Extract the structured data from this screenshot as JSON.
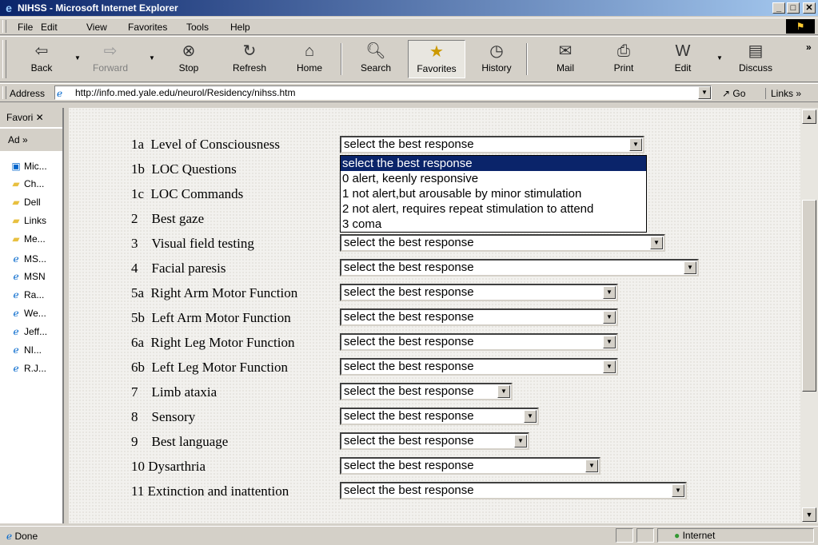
{
  "window": {
    "title": "NIHSS - Microsoft Internet Explorer",
    "min": "_",
    "max": "□",
    "close": "✕"
  },
  "menu": [
    "File",
    "Edit",
    "View",
    "Favorites",
    "Tools",
    "Help"
  ],
  "toolbar": {
    "back": "Back",
    "forward": "Forward",
    "stop": "Stop",
    "refresh": "Refresh",
    "home": "Home",
    "search": "Search",
    "favorites": "Favorites",
    "history": "History",
    "mail": "Mail",
    "print": "Print",
    "edit": "Edit",
    "discuss": "Discuss",
    "more": "»"
  },
  "address": {
    "label": "Address",
    "url": "http://info.med.yale.edu/neurol/Residency/nihss.htm",
    "go": "Go",
    "links": "Links »"
  },
  "sidebar": {
    "header": "Favori ✕",
    "add": "Ad »",
    "items": [
      {
        "icon": "page-icon",
        "label": "Mic..."
      },
      {
        "icon": "folder-icon",
        "label": "Ch..."
      },
      {
        "icon": "folder-icon",
        "label": "Dell"
      },
      {
        "icon": "folder-icon",
        "label": "Links"
      },
      {
        "icon": "folder-icon",
        "label": "Me..."
      },
      {
        "icon": "ie-page-icon",
        "label": "MS..."
      },
      {
        "icon": "ie-page-icon",
        "label": "MSN"
      },
      {
        "icon": "ie-page-icon",
        "label": "Ra..."
      },
      {
        "icon": "ie-page-icon",
        "label": "We..."
      },
      {
        "icon": "ie-page-icon",
        "label": "Jeff..."
      },
      {
        "icon": "ie-page-icon",
        "label": "NI..."
      },
      {
        "icon": "ie-page-icon",
        "label": "R.J..."
      }
    ]
  },
  "form": {
    "placeholder": "select the best response",
    "items": [
      {
        "num": "1a",
        "label": "Level of Consciousness",
        "value": "select the best response"
      },
      {
        "num": "1b",
        "label": "LOC Questions",
        "value": "select the best response"
      },
      {
        "num": "1c",
        "label": "LOC Commands",
        "value": "select the best response"
      },
      {
        "num": "2",
        "label": "Best gaze",
        "value": "select the best response"
      },
      {
        "num": "3",
        "label": "Visual field testing",
        "value": "select the best response"
      },
      {
        "num": "4",
        "label": "Facial paresis",
        "value": "select the best response"
      },
      {
        "num": "5a",
        "label": "Right Arm Motor Function",
        "value": "select the best response"
      },
      {
        "num": "5b",
        "label": "Left Arm Motor Function",
        "value": "select the best response"
      },
      {
        "num": "6a",
        "label": "Right Leg Motor Function",
        "value": "select the best response"
      },
      {
        "num": "6b",
        "label": "Left Leg Motor Function",
        "value": "select the best response"
      },
      {
        "num": "7",
        "label": "Limb ataxia",
        "value": "select the best response"
      },
      {
        "num": "8",
        "label": "Sensory",
        "value": "select the best response"
      },
      {
        "num": "9",
        "label": "Best language",
        "value": "select the best response"
      },
      {
        "num": "10",
        "label": "Dysarthria",
        "value": "select the best response"
      },
      {
        "num": "11",
        "label": "Extinction and inattention",
        "value": "select the best response"
      }
    ],
    "open_dropdown": {
      "options": [
        "select the best response",
        "0 alert, keenly responsive",
        "1 not alert,but arousable by minor stimulation",
        "2 not alert, requires repeat stimulation to attend",
        "3 coma"
      ],
      "highlighted": 0
    }
  },
  "status": {
    "text": "Done",
    "zone": "Internet"
  }
}
